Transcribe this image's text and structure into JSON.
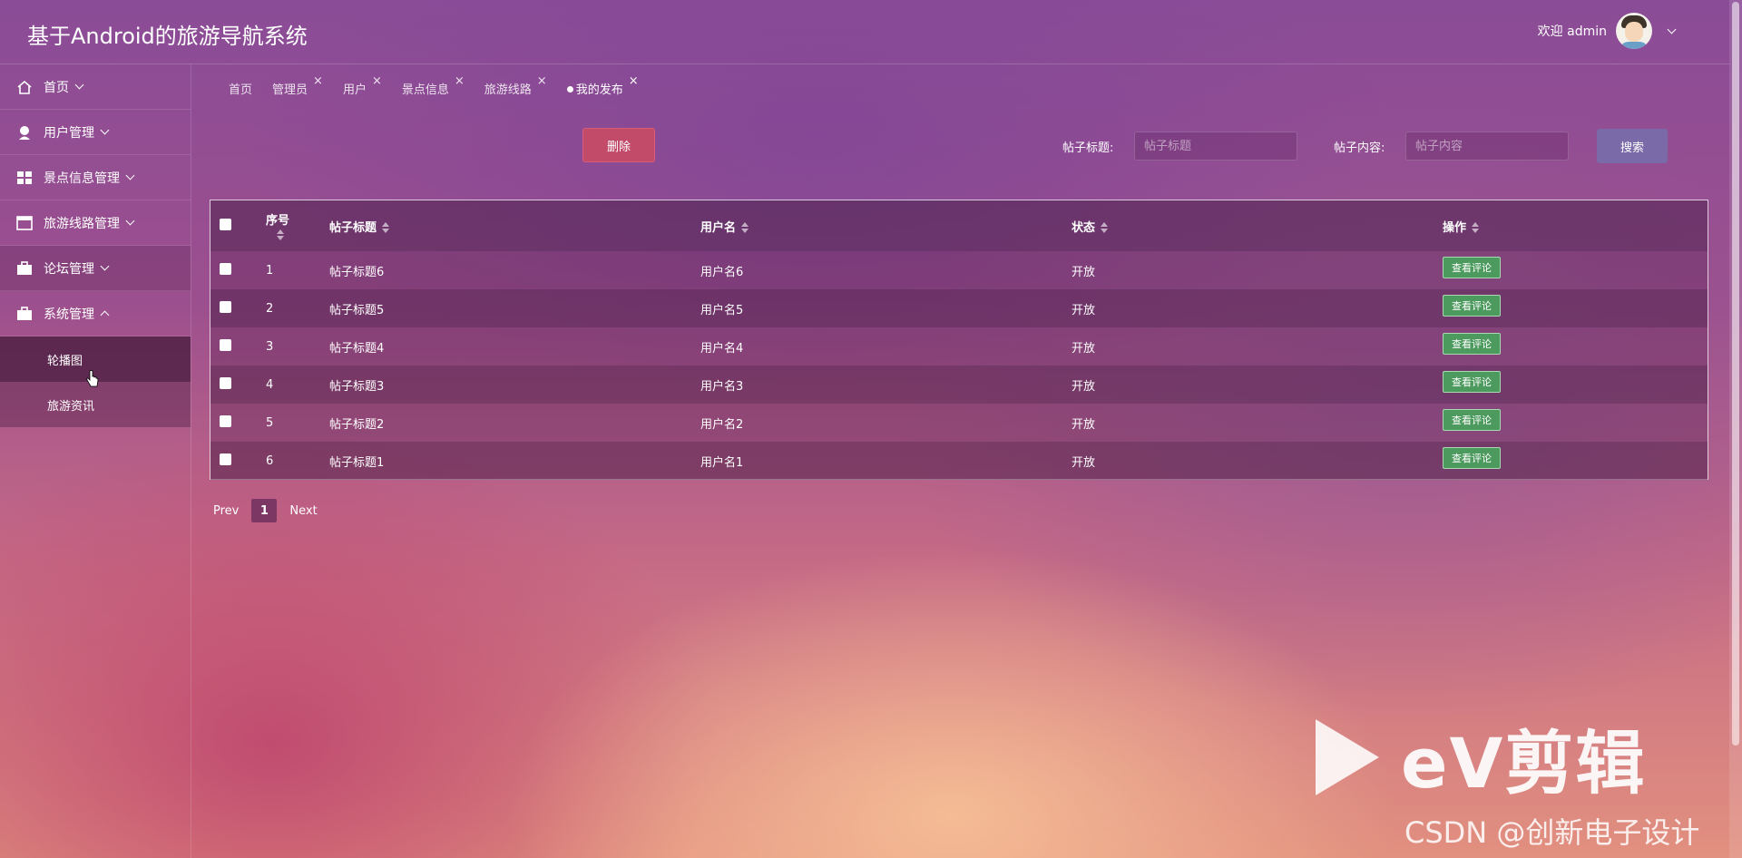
{
  "header": {
    "title": "基于Android的旅游导航系统",
    "welcome": "欢迎 admin"
  },
  "sidebar": {
    "items": [
      {
        "label": "首页",
        "icon": "home-icon"
      },
      {
        "label": "用户管理",
        "icon": "user-icon"
      },
      {
        "label": "景点信息管理",
        "icon": "grid-icon"
      },
      {
        "label": "旅游线路管理",
        "icon": "panel-icon"
      },
      {
        "label": "论坛管理",
        "icon": "briefcase-icon"
      },
      {
        "label": "系统管理",
        "icon": "briefcase-icon"
      }
    ],
    "subitems": [
      {
        "label": "轮播图"
      },
      {
        "label": "旅游资讯"
      }
    ]
  },
  "tabs": [
    "首页",
    "管理员",
    "用户",
    "景点信息",
    "旅游线路",
    "我的发布"
  ],
  "toolbar": {
    "delete_label": "删除",
    "title_label": "帖子标题:",
    "title_placeholder": "帖子标题",
    "content_label": "帖子内容:",
    "content_placeholder": "帖子内容",
    "search_label": "搜索"
  },
  "table": {
    "columns": [
      "序号",
      "帖子标题",
      "用户名",
      "状态",
      "操作"
    ],
    "action_label": "查看评论",
    "rows": [
      {
        "no": "1",
        "title": "帖子标题6",
        "user": "用户名6",
        "status": "开放"
      },
      {
        "no": "2",
        "title": "帖子标题5",
        "user": "用户名5",
        "status": "开放"
      },
      {
        "no": "3",
        "title": "帖子标题4",
        "user": "用户名4",
        "status": "开放"
      },
      {
        "no": "4",
        "title": "帖子标题3",
        "user": "用户名3",
        "status": "开放"
      },
      {
        "no": "5",
        "title": "帖子标题2",
        "user": "用户名2",
        "status": "开放"
      },
      {
        "no": "6",
        "title": "帖子标题1",
        "user": "用户名1",
        "status": "开放"
      }
    ]
  },
  "pagination": {
    "prev": "Prev",
    "page": "1",
    "next": "Next"
  },
  "watermark": {
    "ev": "eV剪辑",
    "csdn": "CSDN @创新电子设计"
  },
  "colors": {
    "delete": "#c24b6a",
    "search": "#7a6aa8",
    "action": "#4c9a5e"
  }
}
